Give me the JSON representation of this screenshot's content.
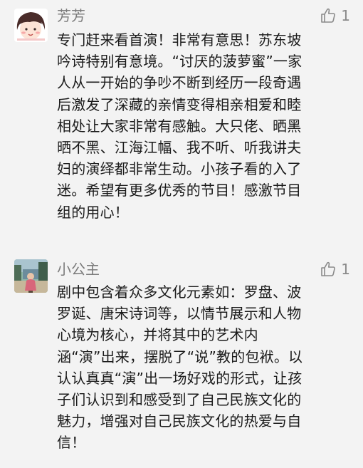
{
  "comments": [
    {
      "username": "芳芳",
      "like_count": "1",
      "text": "专门赶来看首演！非常有意思！苏东坡\n吟诗特别有意境。“讨厌的菠萝蜜”一家\n人从一开始的争吵不断到经历一段奇遇\n后激发了深藏的亲情变得相亲相爱和睦\n相处让大家非常有感触。大只佬、晒黑\n晒不黑、江海江幅、我不听、听我讲夫\n妇的演绎都非常生动。小孩子看的入了\n迷。希望有更多优秀的节目！感激节目\n组的用心！",
      "avatar_icon": "cartoon-girl-avatar"
    },
    {
      "username": "小公主",
      "like_count": "1",
      "text": "剧中包含着众多文化元素如：罗盘、波\n罗诞、唐宋诗词等，以情节展示和人物\n心境为核心，并将其中的艺术内\n涵“演”出来，摆脱了“说”教的包袱。以\n认认真真“演”出一场好戏的形式，让孩\n子们认识到和感受到了自己民族文化的\n魅力，增强对自己民族文化的热爱与自\n信！",
      "avatar_icon": "photo-child-avatar"
    }
  ],
  "colors": {
    "background": "#f3f3f3",
    "username": "#7b7b7b",
    "text": "#1b1b1b",
    "like": "#8a8a8a"
  }
}
